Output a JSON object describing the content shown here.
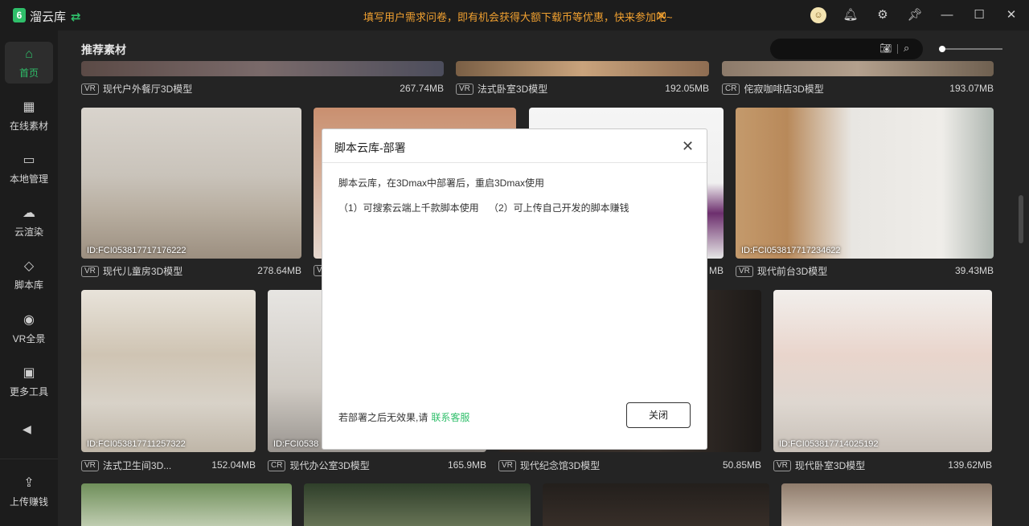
{
  "app": {
    "logo_char": "6",
    "title": "溜云库"
  },
  "notice": {
    "text": "填写用户需求问卷，即有机会获得大额下载币等优惠，快来参加吧~"
  },
  "sidebar": {
    "items": [
      {
        "label": "首页"
      },
      {
        "label": "在线素材"
      },
      {
        "label": "本地管理"
      },
      {
        "label": "云渲染"
      },
      {
        "label": "脚本库"
      },
      {
        "label": "VR全景"
      },
      {
        "label": "更多工具"
      },
      {
        "label": "上传赚钱"
      }
    ]
  },
  "main": {
    "section_title": "推荐素材"
  },
  "cards": [
    {
      "badge": "VR",
      "name": "现代户外餐厅3D模型",
      "size": "267.74MB",
      "id": ""
    },
    {
      "badge": "VR",
      "name": "法式卧室3D模型",
      "size": "192.05MB",
      "id": ""
    },
    {
      "badge": "CR",
      "name": "侘寂咖啡店3D模型",
      "size": "193.07MB",
      "id": ""
    },
    {
      "badge": "VR",
      "name": "现代儿童房3D模型",
      "size": "278.64MB",
      "id": "ID:FCI053817717176222"
    },
    {
      "badge": "VR",
      "name": "",
      "size": "",
      "id": ""
    },
    {
      "badge": "",
      "name": "",
      "size": "MB",
      "id": ""
    },
    {
      "badge": "VR",
      "name": "现代前台3D模型",
      "size": "39.43MB",
      "id": "ID:FCI053817717234622"
    },
    {
      "badge": "VR",
      "name": "法式卫生间3D...",
      "size": "152.04MB",
      "id": "ID:FCI053817711257322"
    },
    {
      "badge": "CR",
      "name": "现代办公室3D模型",
      "size": "165.9MB",
      "id": "ID:FCI0538"
    },
    {
      "badge": "VR",
      "name": "现代纪念馆3D模型",
      "size": "50.85MB",
      "id": ""
    },
    {
      "badge": "VR",
      "name": "现代卧室3D模型",
      "size": "139.62MB",
      "id": "ID:FCI053817714025192"
    }
  ],
  "dialog": {
    "title": "脚本云库-部署",
    "line1": "脚本云库，在3Dmax中部署后，重启3Dmax使用",
    "line2a": "（1）可搜索云端上千款脚本使用",
    "line2b": "（2）可上传自己开发的脚本赚钱",
    "footer": "若部署之后无效果,请",
    "link": "联系客服",
    "close_button": "关闭"
  },
  "colors": {
    "accent": "#2fbf6a",
    "notice": "#f0a030",
    "background": "#242424"
  }
}
